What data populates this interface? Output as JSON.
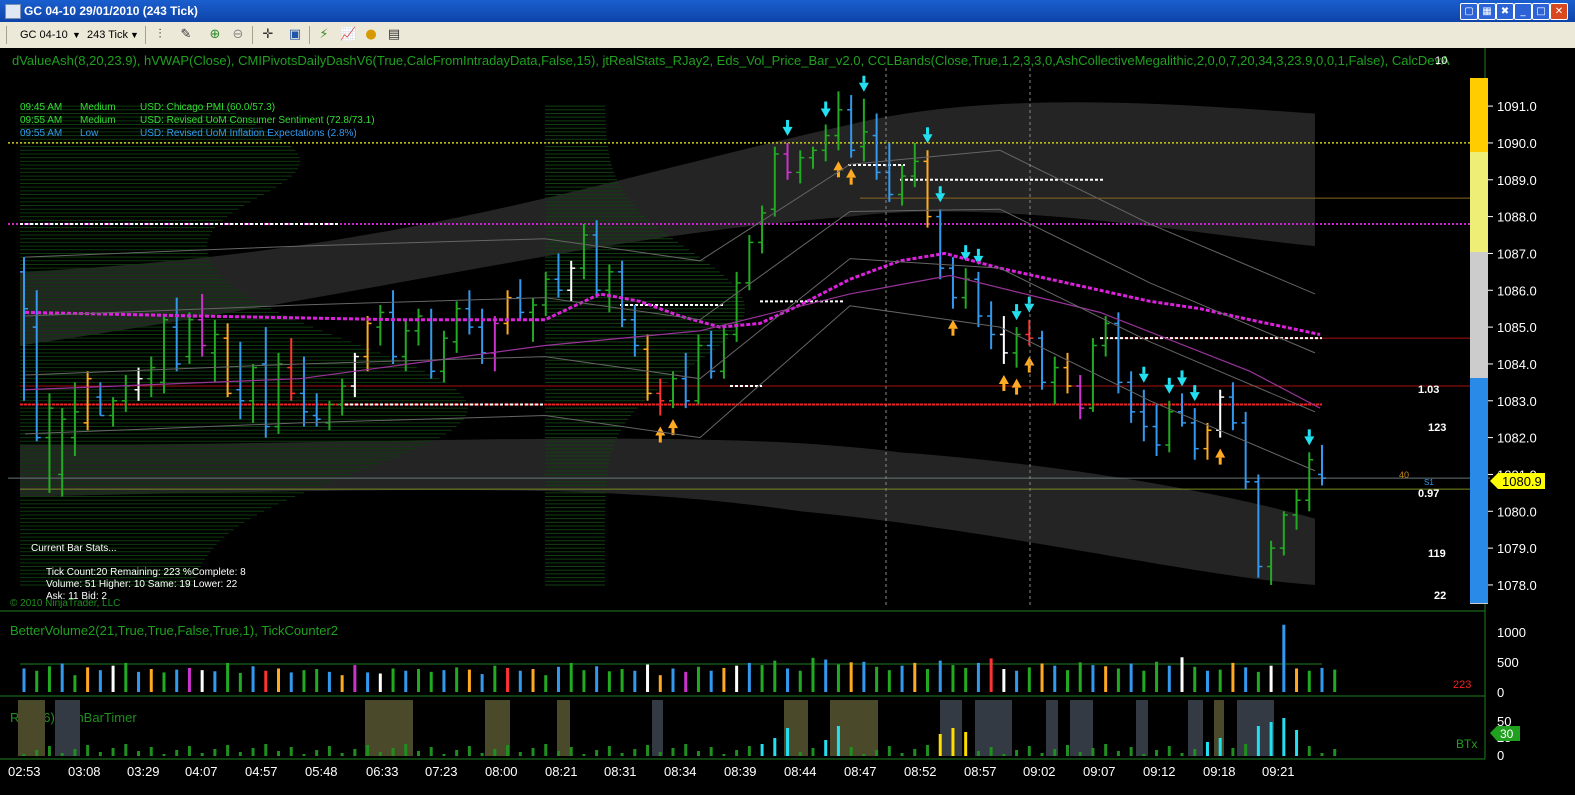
{
  "window": {
    "title": "GC 04-10  29/01/2010 (243 Tick)",
    "buttons": [
      "minimize",
      "maximize",
      "close"
    ]
  },
  "toolbar": {
    "instrument": "GC 04-10",
    "interval": "243 Tick",
    "icons": [
      "bar-style-icon",
      "draw-pen-icon",
      "zoom-in-icon",
      "zoom-out-icon",
      "crosshair-icon",
      "properties-icon",
      "strategy-icon",
      "indicator-icon",
      "coin-icon",
      "data-box-icon"
    ]
  },
  "indicators_label": "dValueAsh(8,20,23.9), hVWAP(Close), CMIPivotsDailyDashV6(True,CalcFromIntradayData,False,15), jtRealStats_RJay2, Eds_Vol_Price_Bar_v2.0, CCLBands(Close,True,1,2,3,3,0,AshCollectiveMegalithic,2,0,0,7,20,34,3,23.9,0,0,1,False), CalcDevA",
  "top_right_badge": "10",
  "news": [
    {
      "time": "09:45 AM",
      "impact": "Medium",
      "text": "USD: Chicago PMI (60.0/57.3)"
    },
    {
      "time": "09:55 AM",
      "impact": "Medium",
      "text": "USD: Revised UoM Consumer Sentiment (72.8/73.1)"
    },
    {
      "time": "09:55 AM",
      "impact": "Low",
      "text": "USD: Revised UoM Inflation Expectations (2.8%)"
    }
  ],
  "bar_stats": {
    "header": "Current Bar Stats...",
    "line1": "Tick Count:20  Remaining: 223  %Complete: 8",
    "line2": "Volume: 51   Higher: 10   Same: 19   Lower: 22",
    "line3": "Ask: 11   Bid: 2"
  },
  "copyright": "© 2010 NinjaTrader, LLC",
  "price_axis": [
    "1091.0",
    "1090.0",
    "1089.0",
    "1088.0",
    "1087.0",
    "1086.0",
    "1085.0",
    "1084.0",
    "1083.0",
    "1082.0",
    "1081.0",
    "1080.0",
    "1079.0",
    "1078.0"
  ],
  "last_price": "1080.9",
  "side_stats": {
    "a": "1.03",
    "b": "123",
    "c": "40",
    "d": "0.97",
    "e": "119",
    "f": "22",
    "s1": "S1"
  },
  "volume_panel": {
    "label": "BetterVolume2(21,True,True,False,True,1), TickCounter2",
    "axis": [
      "1000",
      "500",
      "0"
    ],
    "counter": "223"
  },
  "rpm_panel": {
    "label": "RPM(6), AshBarTimer",
    "axis": [
      "50",
      "25",
      "0"
    ],
    "timer_label": "BTx",
    "timer_value": "30"
  },
  "time_axis": [
    "02:53",
    "03:08",
    "03:29",
    "04:07",
    "04:57",
    "05:48",
    "06:33",
    "07:23",
    "08:00",
    "08:21",
    "08:31",
    "08:34",
    "08:39",
    "08:44",
    "08:47",
    "08:52",
    "08:57",
    "09:02",
    "09:07",
    "09:12",
    "09:18",
    "09:21"
  ],
  "colors": {
    "up": "#22aa22",
    "down": "#3399ee",
    "vwap": "#dd22dd",
    "pivot": "#ff2222",
    "dash": "#ffffff",
    "accent_up_arrow": "#ffaa22",
    "accent_down_arrow": "#22e0f0",
    "price_bg": "#ffff00"
  },
  "chart_data": {
    "type": "candlestick",
    "bars": [
      {
        "o": 1086.5,
        "h": 1086.9,
        "l": 1083.0,
        "c": 1085.5
      },
      {
        "o": 1085.0,
        "h": 1086.0,
        "l": 1081.9,
        "c": 1082.0
      },
      {
        "o": 1082.0,
        "h": 1083.2,
        "l": 1080.5,
        "c": 1082.8
      },
      {
        "o": 1081.0,
        "h": 1082.8,
        "l": 1080.4,
        "c": 1082.5
      },
      {
        "o": 1082.0,
        "h": 1083.5,
        "l": 1081.5,
        "c": 1082.7
      },
      {
        "o": 1082.4,
        "h": 1083.8,
        "l": 1082.2,
        "c": 1083.6
      },
      {
        "o": 1083.1,
        "h": 1083.5,
        "l": 1082.6,
        "c": 1082.6
      },
      {
        "o": 1082.6,
        "h": 1083.1,
        "l": 1082.3,
        "c": 1083.0
      },
      {
        "o": 1083.0,
        "h": 1083.7,
        "l": 1082.7,
        "c": 1083.4
      },
      {
        "o": 1083.3,
        "h": 1083.9,
        "l": 1083.0,
        "c": 1083.6
      },
      {
        "o": 1083.6,
        "h": 1084.2,
        "l": 1083.1,
        "c": 1083.9
      },
      {
        "o": 1083.5,
        "h": 1085.3,
        "l": 1083.2,
        "c": 1085.2
      },
      {
        "o": 1085.0,
        "h": 1085.8,
        "l": 1083.8,
        "c": 1084.0
      },
      {
        "o": 1084.2,
        "h": 1085.4,
        "l": 1084.0,
        "c": 1085.2
      },
      {
        "o": 1085.2,
        "h": 1085.9,
        "l": 1084.2,
        "c": 1084.5
      },
      {
        "o": 1084.3,
        "h": 1085.2,
        "l": 1083.5,
        "c": 1084.8
      },
      {
        "o": 1084.7,
        "h": 1085.1,
        "l": 1083.1,
        "c": 1083.2
      },
      {
        "o": 1083.3,
        "h": 1084.6,
        "l": 1082.5,
        "c": 1083.0
      },
      {
        "o": 1083.0,
        "h": 1084.0,
        "l": 1082.4,
        "c": 1083.9
      },
      {
        "o": 1084.0,
        "h": 1085.0,
        "l": 1082.0,
        "c": 1082.3
      },
      {
        "o": 1082.3,
        "h": 1084.3,
        "l": 1082.1,
        "c": 1084.0
      },
      {
        "o": 1083.9,
        "h": 1084.7,
        "l": 1083.0,
        "c": 1083.2
      },
      {
        "o": 1083.2,
        "h": 1084.2,
        "l": 1082.3,
        "c": 1082.7
      },
      {
        "o": 1082.6,
        "h": 1083.2,
        "l": 1082.3,
        "c": 1082.5
      },
      {
        "o": 1082.4,
        "h": 1083.0,
        "l": 1082.2,
        "c": 1082.9
      },
      {
        "o": 1082.9,
        "h": 1083.6,
        "l": 1082.6,
        "c": 1083.4
      },
      {
        "o": 1083.4,
        "h": 1084.3,
        "l": 1083.1,
        "c": 1084.2
      },
      {
        "o": 1084.2,
        "h": 1085.3,
        "l": 1083.8,
        "c": 1085.1
      },
      {
        "o": 1085.0,
        "h": 1085.6,
        "l": 1084.5,
        "c": 1085.4
      },
      {
        "o": 1085.4,
        "h": 1086.0,
        "l": 1084.0,
        "c": 1084.2
      },
      {
        "o": 1084.2,
        "h": 1085.2,
        "l": 1083.8,
        "c": 1084.9
      },
      {
        "o": 1084.9,
        "h": 1085.5,
        "l": 1084.5,
        "c": 1085.3
      },
      {
        "o": 1085.2,
        "h": 1085.5,
        "l": 1083.6,
        "c": 1083.8
      },
      {
        "o": 1083.8,
        "h": 1084.9,
        "l": 1083.5,
        "c": 1084.7
      },
      {
        "o": 1084.6,
        "h": 1085.7,
        "l": 1084.3,
        "c": 1085.5
      },
      {
        "o": 1085.5,
        "h": 1086.0,
        "l": 1084.8,
        "c": 1085.0
      },
      {
        "o": 1085.0,
        "h": 1085.5,
        "l": 1084.0,
        "c": 1084.3
      },
      {
        "o": 1084.3,
        "h": 1085.3,
        "l": 1083.8,
        "c": 1085.1
      },
      {
        "o": 1085.1,
        "h": 1086.0,
        "l": 1084.8,
        "c": 1085.8
      },
      {
        "o": 1085.8,
        "h": 1086.3,
        "l": 1085.2,
        "c": 1085.4
      },
      {
        "o": 1085.4,
        "h": 1085.8,
        "l": 1084.6,
        "c": 1085.6
      },
      {
        "o": 1085.6,
        "h": 1086.5,
        "l": 1085.3,
        "c": 1086.3
      },
      {
        "o": 1086.3,
        "h": 1087.0,
        "l": 1085.8,
        "c": 1086.0
      },
      {
        "o": 1086.0,
        "h": 1086.8,
        "l": 1085.7,
        "c": 1086.6
      },
      {
        "o": 1086.6,
        "h": 1087.8,
        "l": 1086.3,
        "c": 1087.5
      },
      {
        "o": 1087.5,
        "h": 1087.9,
        "l": 1085.8,
        "c": 1086.0
      },
      {
        "o": 1086.0,
        "h": 1086.7,
        "l": 1085.4,
        "c": 1086.5
      },
      {
        "o": 1086.5,
        "h": 1086.8,
        "l": 1085.0,
        "c": 1085.2
      },
      {
        "o": 1085.2,
        "h": 1085.6,
        "l": 1084.2,
        "c": 1084.5
      },
      {
        "o": 1084.4,
        "h": 1084.8,
        "l": 1083.0,
        "c": 1083.2
      },
      {
        "o": 1083.2,
        "h": 1083.6,
        "l": 1082.6,
        "c": 1083.0
      },
      {
        "o": 1083.0,
        "h": 1083.8,
        "l": 1082.8,
        "c": 1083.6
      },
      {
        "o": 1083.6,
        "h": 1084.3,
        "l": 1082.8,
        "c": 1083.0
      },
      {
        "o": 1083.0,
        "h": 1084.8,
        "l": 1082.9,
        "c": 1084.5
      },
      {
        "o": 1084.5,
        "h": 1084.9,
        "l": 1083.6,
        "c": 1083.8
      },
      {
        "o": 1083.8,
        "h": 1085.0,
        "l": 1083.6,
        "c": 1084.8
      },
      {
        "o": 1084.8,
        "h": 1086.5,
        "l": 1084.6,
        "c": 1086.2
      },
      {
        "o": 1086.2,
        "h": 1087.5,
        "l": 1086.0,
        "c": 1087.3
      },
      {
        "o": 1087.3,
        "h": 1088.3,
        "l": 1087.0,
        "c": 1088.1
      },
      {
        "o": 1088.2,
        "h": 1089.9,
        "l": 1088.0,
        "c": 1089.7
      },
      {
        "o": 1089.7,
        "h": 1090.0,
        "l": 1089.0,
        "c": 1089.2
      },
      {
        "o": 1089.2,
        "h": 1089.8,
        "l": 1088.9,
        "c": 1089.6
      },
      {
        "o": 1089.6,
        "h": 1089.9,
        "l": 1089.3,
        "c": 1089.8
      },
      {
        "o": 1089.8,
        "h": 1090.5,
        "l": 1089.5,
        "c": 1090.2
      },
      {
        "o": 1090.2,
        "h": 1091.4,
        "l": 1089.8,
        "c": 1090.9
      },
      {
        "o": 1090.9,
        "h": 1091.3,
        "l": 1089.6,
        "c": 1089.8
      },
      {
        "o": 1089.9,
        "h": 1091.2,
        "l": 1089.5,
        "c": 1090.3
      },
      {
        "o": 1090.2,
        "h": 1090.8,
        "l": 1089.0,
        "c": 1089.2
      },
      {
        "o": 1089.2,
        "h": 1090.0,
        "l": 1088.4,
        "c": 1088.6
      },
      {
        "o": 1088.6,
        "h": 1089.4,
        "l": 1088.3,
        "c": 1089.1
      },
      {
        "o": 1089.1,
        "h": 1090.0,
        "l": 1088.8,
        "c": 1089.5
      },
      {
        "o": 1089.5,
        "h": 1089.8,
        "l": 1087.7,
        "c": 1088.0
      },
      {
        "o": 1088.0,
        "h": 1088.2,
        "l": 1086.3,
        "c": 1086.6
      },
      {
        "o": 1086.6,
        "h": 1086.9,
        "l": 1085.5,
        "c": 1085.8
      },
      {
        "o": 1085.8,
        "h": 1086.6,
        "l": 1085.5,
        "c": 1086.3
      },
      {
        "o": 1086.3,
        "h": 1086.5,
        "l": 1085.0,
        "c": 1085.3
      },
      {
        "o": 1085.3,
        "h": 1085.7,
        "l": 1084.4,
        "c": 1084.8
      },
      {
        "o": 1084.8,
        "h": 1085.3,
        "l": 1084.0,
        "c": 1084.3
      },
      {
        "o": 1084.3,
        "h": 1085.0,
        "l": 1083.9,
        "c": 1084.8
      },
      {
        "o": 1084.8,
        "h": 1085.2,
        "l": 1084.5,
        "c": 1084.7
      },
      {
        "o": 1084.7,
        "h": 1084.9,
        "l": 1083.3,
        "c": 1083.5
      },
      {
        "o": 1083.5,
        "h": 1084.2,
        "l": 1082.9,
        "c": 1083.9
      },
      {
        "o": 1083.9,
        "h": 1084.3,
        "l": 1083.2,
        "c": 1083.4
      },
      {
        "o": 1083.4,
        "h": 1083.7,
        "l": 1082.5,
        "c": 1082.8
      },
      {
        "o": 1082.8,
        "h": 1084.7,
        "l": 1082.7,
        "c": 1084.5
      },
      {
        "o": 1084.5,
        "h": 1085.3,
        "l": 1084.2,
        "c": 1085.1
      },
      {
        "o": 1085.1,
        "h": 1085.4,
        "l": 1083.2,
        "c": 1083.5
      },
      {
        "o": 1083.5,
        "h": 1083.8,
        "l": 1082.4,
        "c": 1082.7
      },
      {
        "o": 1082.7,
        "h": 1083.3,
        "l": 1081.9,
        "c": 1082.3
      },
      {
        "o": 1082.3,
        "h": 1082.9,
        "l": 1081.5,
        "c": 1081.8
      },
      {
        "o": 1081.8,
        "h": 1083.0,
        "l": 1081.6,
        "c": 1082.7
      },
      {
        "o": 1082.7,
        "h": 1083.2,
        "l": 1082.3,
        "c": 1082.4
      },
      {
        "o": 1082.4,
        "h": 1082.8,
        "l": 1081.4,
        "c": 1081.7
      },
      {
        "o": 1081.7,
        "h": 1082.4,
        "l": 1081.4,
        "c": 1082.2
      },
      {
        "o": 1082.2,
        "h": 1083.3,
        "l": 1082.0,
        "c": 1083.1
      },
      {
        "o": 1083.1,
        "h": 1083.5,
        "l": 1082.2,
        "c": 1082.4
      },
      {
        "o": 1082.4,
        "h": 1082.7,
        "l": 1080.6,
        "c": 1080.8
      },
      {
        "o": 1080.8,
        "h": 1081.0,
        "l": 1078.2,
        "c": 1078.5
      },
      {
        "o": 1078.5,
        "h": 1079.2,
        "l": 1078.0,
        "c": 1079.0
      },
      {
        "o": 1079.0,
        "h": 1080.0,
        "l": 1078.8,
        "c": 1079.9
      },
      {
        "o": 1079.9,
        "h": 1080.6,
        "l": 1079.5,
        "c": 1080.3
      },
      {
        "o": 1080.3,
        "h": 1081.6,
        "l": 1080.0,
        "c": 1081.4
      },
      {
        "o": 1081.0,
        "h": 1081.8,
        "l": 1080.7,
        "c": 1080.9
      }
    ],
    "volume": [
      420,
      380,
      460,
      510,
      300,
      440,
      390,
      470,
      520,
      360,
      410,
      350,
      400,
      430,
      390,
      370,
      520,
      340,
      460,
      380,
      420,
      350,
      390,
      410,
      360,
      300,
      480,
      350,
      330,
      420,
      380,
      410,
      360,
      390,
      440,
      400,
      320,
      470,
      430,
      380,
      410,
      300,
      450,
      520,
      390,
      460,
      370,
      410,
      380,
      490,
      300,
      420,
      360,
      450,
      380,
      430,
      470,
      520,
      480,
      560,
      420,
      380,
      610,
      580,
      490,
      530,
      540,
      450,
      390,
      470,
      520,
      410,
      560,
      480,
      430,
      520,
      600,
      410,
      380,
      440,
      510,
      470,
      390,
      530,
      480,
      460,
      420,
      510,
      380,
      540,
      470,
      620,
      450,
      380,
      400,
      520,
      440,
      360,
      470,
      1200,
      420,
      380,
      430,
      400
    ],
    "pivot_lines": [
      1083.0,
      1084.7,
      1087.8,
      1089.9
    ],
    "ylim": [
      1077.7,
      1091.6
    ]
  }
}
